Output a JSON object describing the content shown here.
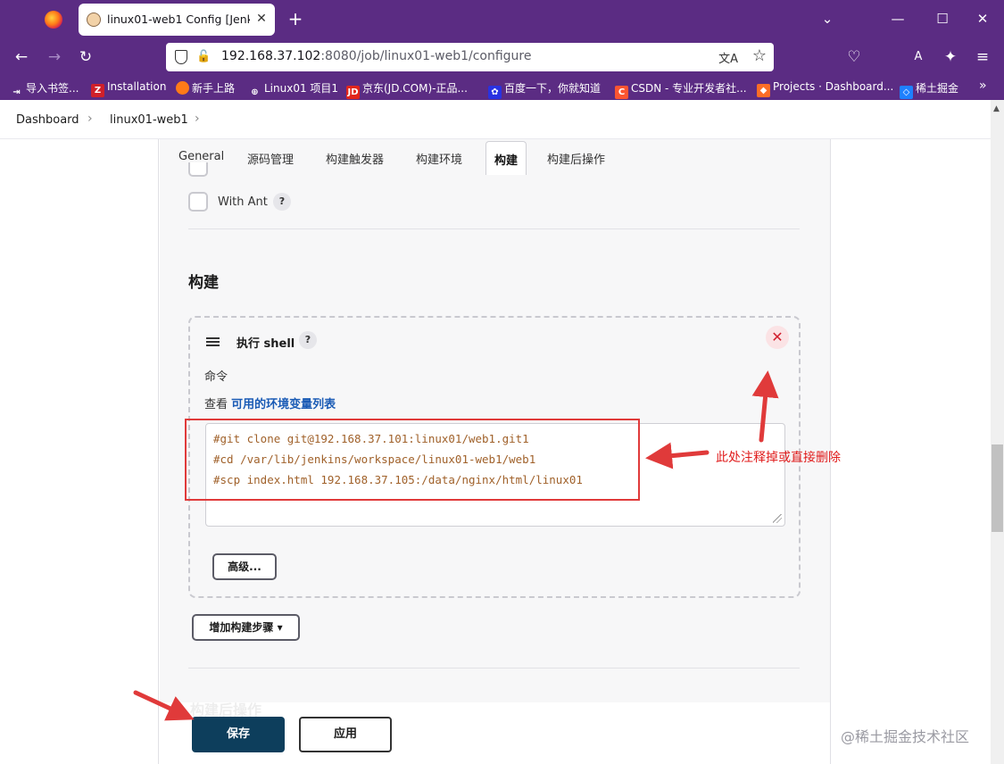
{
  "browser": {
    "tab_title": "linux01-web1 Config [Jenkins]",
    "url_host": "192.168.37.102",
    "url_rest": ":8080/job/linux01-web1/configure",
    "bookmarks": [
      "导入书签...",
      "Installation",
      "新手上路",
      "Linux01 项目1",
      "京东(JD.COM)-正品...",
      "百度一下，你就知道",
      "CSDN - 专业开发者社...",
      "Projects · Dashboard...",
      "稀土掘金"
    ]
  },
  "breadcrumb": {
    "items": [
      "Dashboard",
      "linux01-web1"
    ]
  },
  "config_tabs": [
    "General",
    "源码管理",
    "构建触发器",
    "构建环境",
    "构建",
    "构建后操作"
  ],
  "env_options": {
    "with_ant": "With Ant"
  },
  "build_section": {
    "title": "构建",
    "step_title": "执行 shell",
    "command_label": "命令",
    "env_prefix": "查看",
    "env_link": "可用的环境变量列表",
    "commands": [
      "#git clone git@192.168.37.101:linux01/web1.git1",
      "#cd /var/lib/jenkins/workspace/linux01-web1/web1",
      "#scp index.html 192.168.37.105:/data/nginx/html/linux01"
    ],
    "advanced_button": "高级...",
    "add_step_button": "增加构建步骤"
  },
  "post_build_title": "构建后操作",
  "footer": {
    "save": "保存",
    "apply": "应用"
  },
  "annotation": "此处注释掉或直接删除",
  "watermark": "@稀土掘金技术社区",
  "colors": {
    "browser_chrome": "#5b2c83",
    "save_button": "#0d3e5c",
    "annotation_red": "#e03a3a",
    "link_blue": "#1a5bb5"
  }
}
